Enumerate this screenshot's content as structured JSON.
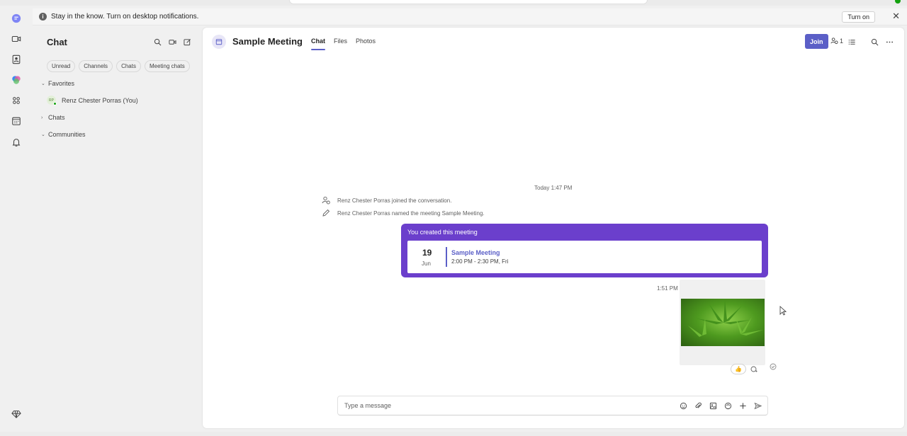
{
  "banner": {
    "text": "Stay in the know. Turn on desktop notifications.",
    "turn_on_label": "Turn on"
  },
  "rail": {
    "icons": [
      "chat-icon",
      "video-icon",
      "people-icon",
      "copilot-icon",
      "teams-icon",
      "calendar-icon",
      "bell-icon",
      "diamond-icon"
    ]
  },
  "left_pane": {
    "title": "Chat",
    "filters": [
      "Unread",
      "Channels",
      "Chats",
      "Meeting chats"
    ],
    "sections": {
      "favorites": "Favorites",
      "chats": "Chats",
      "communities": "Communities"
    },
    "favorite_items": [
      {
        "initials": "RP",
        "name": "Renz Chester Porras (You)"
      }
    ]
  },
  "header": {
    "title": "Sample Meeting",
    "tabs": [
      "Chat",
      "Files",
      "Photos"
    ],
    "join_label": "Join",
    "participant_count": "1"
  },
  "conversation": {
    "timestamp": "Today 1:47 PM",
    "system_messages": [
      "Renz Chester Porras joined the conversation.",
      "Renz Chester Porras named the meeting Sample Meeting."
    ],
    "meeting_card": {
      "header": "You created this meeting",
      "day": "19",
      "month": "Jun",
      "name": "Sample Meeting",
      "time": "2:00 PM - 2:30 PM, Fri"
    },
    "image_message_time": "1:51 PM",
    "reaction": "👍"
  },
  "compose": {
    "placeholder": "Type a message"
  },
  "colors": {
    "brand": "#5b5fc7",
    "meeting_card": "#6b3fcc",
    "presence": "#13a10e"
  }
}
